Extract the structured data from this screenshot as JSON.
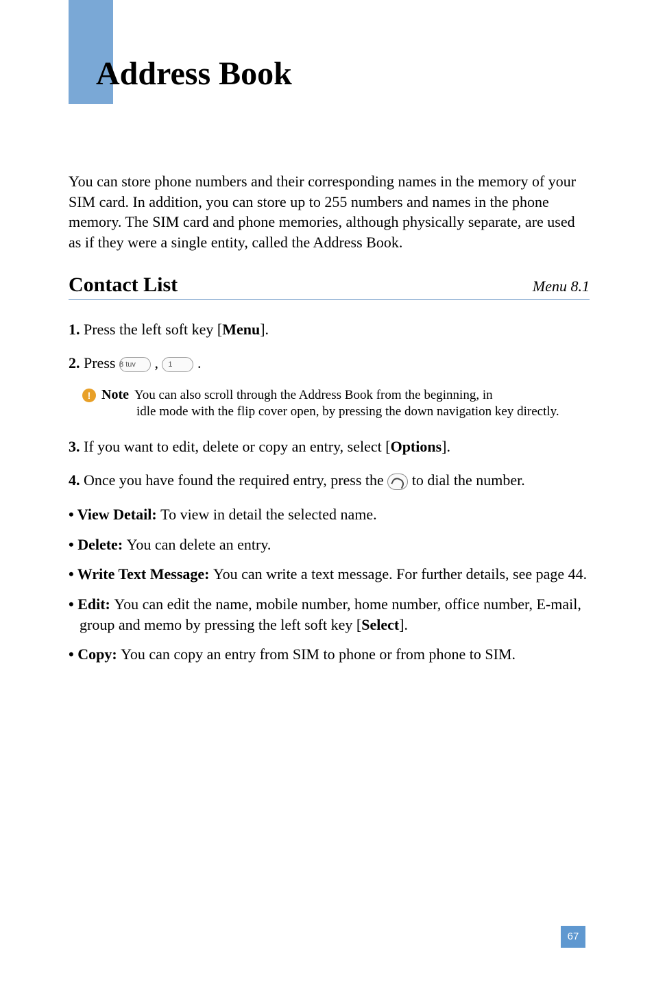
{
  "page_title": "Address Book",
  "intro": "You can store phone numbers and their corresponding names in the memory of your SIM card. In addition, you can store up to 255 numbers and names in the phone memory. The SIM card and phone memories, although physically separate, are used as if they were a single entity, called the Address Book.",
  "section": {
    "title": "Contact List",
    "menu_ref": "Menu 8.1"
  },
  "steps": {
    "s1_prefix": "1. ",
    "s1_a": "Press the left soft key [",
    "s1_b": "Menu",
    "s1_c": "].",
    "s2_prefix": "2. ",
    "s2_a": "Press ",
    "s2_comma": " , ",
    "s2_period": " .",
    "key8": "8 tuv",
    "key1": "1",
    "s3_prefix": "3. ",
    "s3_a": "If you want to edit, delete or copy an entry, select [",
    "s3_b": "Options",
    "s3_c": "].",
    "s4_prefix": "4. ",
    "s4_a": "Once you have found the required entry, press the ",
    "s4_b": " to dial the number."
  },
  "note": {
    "label": "Note",
    "text_first": "You can also scroll through the Address Book from the beginning, in",
    "text_rest": "idle mode with the flip cover open, by pressing the down navigation key directly."
  },
  "bullets": {
    "b1_label": "• View Detail: ",
    "b1_text": "To view in detail the selected name.",
    "b2_label": "• Delete: ",
    "b2_text": "You can delete an entry.",
    "b3_label": "• Write Text Message: ",
    "b3_text": "You can write a text message. For further details, see page 44.",
    "b4_label": "• Edit: ",
    "b4_text_a": "You can edit the name, mobile number, home number, office number, E-mail, group and memo by pressing the left soft key [",
    "b4_text_b": "Select",
    "b4_text_c": "].",
    "b5_label": "• Copy: ",
    "b5_text": "You can copy an entry from SIM to phone or from phone to SIM."
  },
  "page_number": "67",
  "icons": {
    "note_exclaim": "!"
  }
}
